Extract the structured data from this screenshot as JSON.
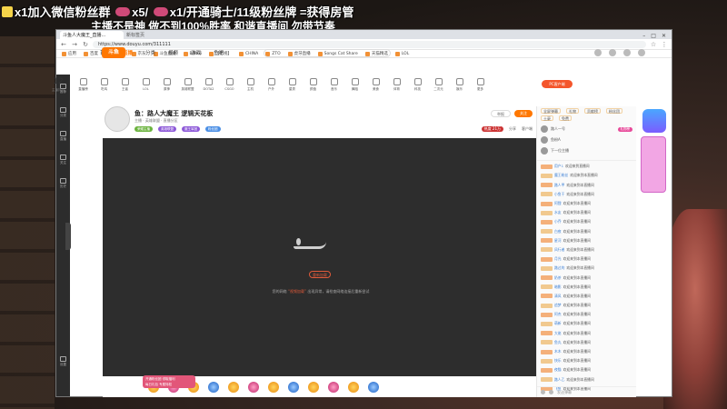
{
  "overlay": {
    "line1_a": "x1加入微信粉丝群",
    "line1_b": "x5/",
    "line1_c": "x1/开通骑士/11级粉丝牌 =获得房管",
    "line2": "主播不是神 做不到100%胜率 和谐直播间 勿带节奏"
  },
  "browser": {
    "tabs": [
      "斗鱼人大魔王_直播...",
      "新标签页"
    ],
    "url": "https://www.douyu.com/311111",
    "bookmarks": [
      "应用",
      "百度",
      "淘宝网",
      "京东",
      "斗鱼直播",
      "Bilibili",
      "【影视】",
      "CHINA",
      "ZTO",
      "虎牙直播",
      "Songs Cat Share",
      "天猫精选",
      "LOL"
    ]
  },
  "sidebar": {
    "items": [
      "推荐",
      "分类",
      "直播",
      "关注",
      "历史",
      "设置"
    ]
  },
  "site": {
    "logo": "斗鱼",
    "nav": [
      "首页",
      "直播",
      "分类",
      "视频",
      "游戏",
      "鱼吧"
    ],
    "active_nav": "直播"
  },
  "categories": {
    "date_num": "12",
    "date_label": "主播排行",
    "items": [
      "直播榜",
      "吃鸡",
      "王者",
      "LOL",
      "原神",
      "英雄联盟",
      "DOTA2",
      "CSGO",
      "主机",
      "户外",
      "星秀",
      "颜值",
      "音乐",
      "舞蹈",
      "美食",
      "体育",
      "科技",
      "二次元",
      "娱乐",
      "更多"
    ],
    "pill": "PC客户端"
  },
  "streamer": {
    "title": "鱼：路人大魔王 逻辑天花板",
    "meta": "主播 · 英雄联盟 · 直播分区",
    "badges": [
      "荣耀主播",
      "英雄联盟",
      "魔王军团",
      "粉丝团"
    ],
    "report": "举报",
    "follow": "关注",
    "stats": [
      "热度 21万",
      "分享",
      "客户端"
    ]
  },
  "player": {
    "retry": "重新加载",
    "message_prefix": "您的网络 ",
    "message_highlight": "“视频加载”",
    "message_suffix": " 出现异常，请检查网络连接后重新尝试"
  },
  "promo": {
    "line1": "开通粉丝团 领取福利",
    "line2": "每日礼包 专属特权"
  },
  "chat": {
    "tabs": [
      "全屏弹幕",
      "礼物",
      "贡献榜",
      "粉丝团",
      "土豪",
      "免费"
    ],
    "rank": [
      {
        "name": "路人一号",
        "pill": "礼物榜"
      },
      {
        "name": "鱼粉A",
        "pill": ""
      },
      {
        "name": "下一位主播",
        "pill": ""
      }
    ],
    "messages": [
      {
        "user": "用户1",
        "text": "欢迎来到直播间"
      },
      {
        "user": "魔王粉丝",
        "text": "欢迎来到本直播间"
      },
      {
        "user": "路人甲",
        "text": "欢迎来到本直播间"
      },
      {
        "user": "小鱼干",
        "text": "欢迎来到本直播间"
      },
      {
        "user": "阿狸",
        "text": "欢迎来到本直播间"
      },
      {
        "user": "水友",
        "text": "欢迎来到本直播间"
      },
      {
        "user": "小乔",
        "text": "欢迎来到本直播间"
      },
      {
        "user": "白夜",
        "text": "欢迎来到本直播间"
      },
      {
        "user": "星河",
        "text": "欢迎来到本直播间"
      },
      {
        "user": "风行者",
        "text": "欢迎来到本直播间"
      },
      {
        "user": "月光",
        "text": "欢迎来到本直播间"
      },
      {
        "user": "路过的",
        "text": "欢迎来到本直播间"
      },
      {
        "user": "奶茶",
        "text": "欢迎来到本直播间"
      },
      {
        "user": "暗影",
        "text": "欢迎来到本直播间"
      },
      {
        "user": "清风",
        "text": "欢迎来到本直播间"
      },
      {
        "user": "追梦",
        "text": "欢迎来到本直播间"
      },
      {
        "user": "阿杰",
        "text": "欢迎来到本直播间"
      },
      {
        "user": "萌新",
        "text": "欢迎来到本直播间"
      },
      {
        "user": "大佬",
        "text": "欢迎来到本直播间"
      },
      {
        "user": "鱼丸",
        "text": "欢迎来到本直播间"
      },
      {
        "user": "木木",
        "text": "欢迎来到本直播间"
      },
      {
        "user": "快乐",
        "text": "欢迎来到本直播间"
      },
      {
        "user": "夜猫",
        "text": "欢迎来到本直播间"
      },
      {
        "user": "路人乙",
        "text": "欢迎来到本直播间"
      },
      {
        "user": "飞鱼",
        "text": "欢迎来到本直播间"
      }
    ],
    "input_placeholder": "发送弹幕"
  },
  "colors": {
    "accent": "#ff7700",
    "player_bg": "#2d2d2d",
    "error": "#e05a3a"
  }
}
